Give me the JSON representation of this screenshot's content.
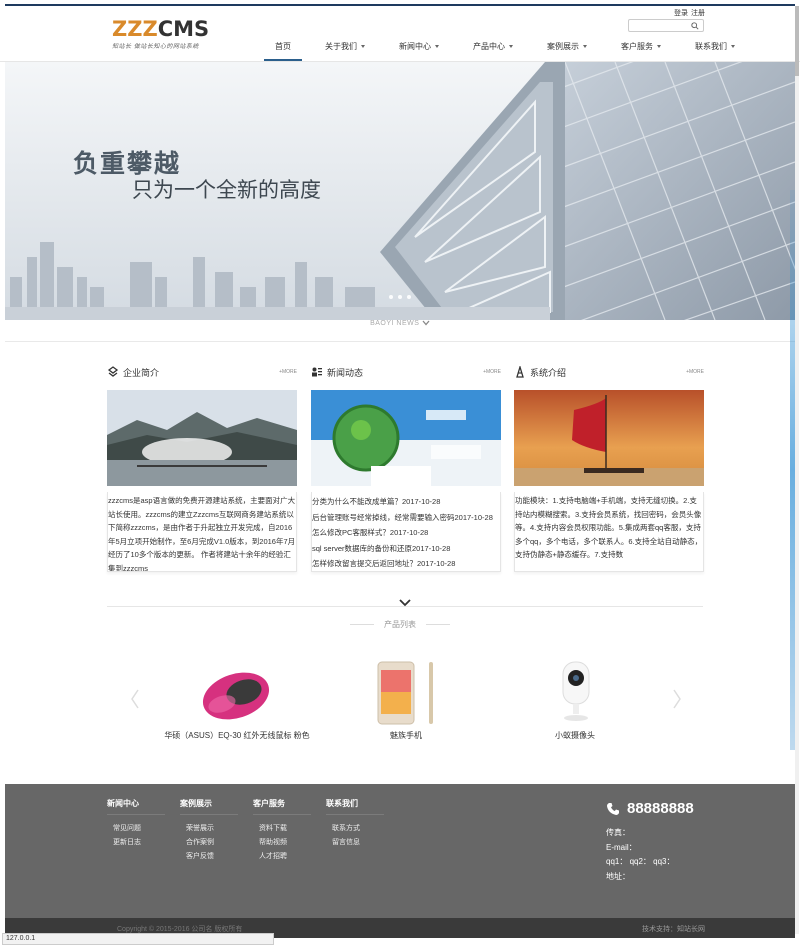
{
  "header": {
    "logo_text_a": "ZZZ",
    "logo_text_b": "CMS",
    "slogan": "知站长 做站长知心的网站系统",
    "login": "登录",
    "register": "注册",
    "search_placeholder": ""
  },
  "nav": [
    {
      "label": "首页",
      "active": true,
      "has_menu": false
    },
    {
      "label": "关于我们",
      "active": false,
      "has_menu": true
    },
    {
      "label": "新闻中心",
      "active": false,
      "has_menu": true
    },
    {
      "label": "产品中心",
      "active": false,
      "has_menu": true
    },
    {
      "label": "案例展示",
      "active": false,
      "has_menu": true
    },
    {
      "label": "客户服务",
      "active": false,
      "has_menu": true
    },
    {
      "label": "联系我们",
      "active": false,
      "has_menu": true
    }
  ],
  "banner": {
    "title": "负重攀越",
    "subtitle": "只为一个全新的高度",
    "caption": "BAOYI NEWS"
  },
  "sections": {
    "about": {
      "title": "企业简介",
      "more": "+MORE",
      "text": "zzzcms是asp语言做的免费开源建站系统，主要面对广大站长使用。zzzcms的建立Zzzcms互联网商务建站系统以下简称zzzcms，是由作者于升起独立开发完成，自2016年5月立项开始制作，至6月完成V1.0版本，到2016年7月经历了10多个版本的更新。 作者将建站十余年的经验汇集到zzzcms"
    },
    "news": {
      "title": "新闻动态",
      "more": "+MORE",
      "items": [
        "分类为什么不能改成单篇？2017-10-28",
        "后台管理账号经常掉线，经常需要输入密码2017-10-28",
        "怎么修改PC客服样式？2017-10-28",
        "sql server数据库的备份和还原2017-10-28",
        "怎样修改留言提交后返回地址？2017-10-28"
      ]
    },
    "system": {
      "title": "系统介绍",
      "more": "+MORE",
      "text": "功能模块：1.支持电脑端+手机端，支持无缝切换。2.支持站内模糊搜索。3.支持会员系统，找回密码，会员头像等。4.支持内容会员权限功能。5.集成两套qq客服，支持多个qq，多个电话，多个联系人。6.支持全站自动静态，支持伪静态+静态缓存。7.支持数"
    }
  },
  "products": {
    "title": "产品列表",
    "items": [
      {
        "name": "华硕（ASUS）EQ-30 红外无线鼠标 粉色"
      },
      {
        "name": "魅族手机"
      },
      {
        "name": "小蚁摄像头"
      }
    ]
  },
  "footer": {
    "columns": [
      {
        "title": "新闻中心",
        "links": [
          "常见问题",
          "更新日志"
        ]
      },
      {
        "title": "案例展示",
        "links": [
          "荣誉展示",
          "合作案例",
          "客户反馈"
        ]
      },
      {
        "title": "客户服务",
        "links": [
          "资料下载",
          "帮助视频",
          "人才招聘"
        ]
      },
      {
        "title": "联系我们",
        "links": [
          "联系方式",
          "留言信息"
        ]
      }
    ],
    "phone": "88888888",
    "fax": "传真：",
    "email": "E-mail：",
    "qq": "qq1： qq2： qq3：",
    "address": "地址：",
    "copyright": "Copyright © 2015-2016 公司名 版权所有",
    "support": "技术支持：知站长网"
  },
  "statusbar": "127.0.0.1",
  "colors": {
    "accent": "#2b5f8c",
    "logo_orange": "#d98a2b",
    "footer_bg": "#676767",
    "bottom_bg": "#3a3a3a"
  }
}
